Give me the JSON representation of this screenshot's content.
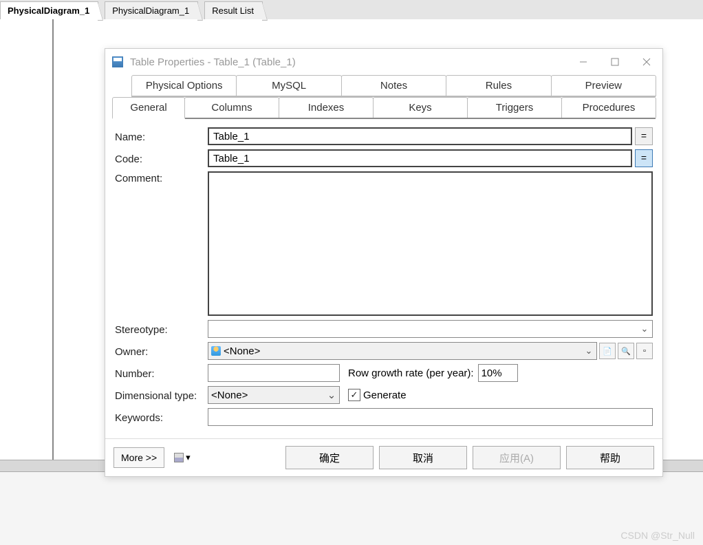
{
  "bg_tabs": [
    "PhysicalDiagram_1",
    "PhysicalDiagram_1",
    "Result List"
  ],
  "bg_active_tab": 0,
  "dialog": {
    "title": "Table Properties - Table_1 (Table_1)",
    "tabs_row1": [
      "Physical Options",
      "MySQL",
      "Notes",
      "Rules",
      "Preview"
    ],
    "tabs_row2": [
      "General",
      "Columns",
      "Indexes",
      "Keys",
      "Triggers",
      "Procedures"
    ],
    "active_tab": "General",
    "form": {
      "name_label": "Name:",
      "name_value": "Table_1",
      "code_label": "Code:",
      "code_value": "Table_1",
      "comment_label": "Comment:",
      "comment_value": "",
      "stereotype_label": "Stereotype:",
      "stereotype_value": "",
      "owner_label": "Owner:",
      "owner_value": "<None>",
      "number_label": "Number:",
      "number_value": "",
      "rowgrowth_label": "Row growth rate (per year):",
      "rowgrowth_value": "10%",
      "dimtype_label": "Dimensional type:",
      "dimtype_value": "<None>",
      "generate_label": "Generate",
      "generate_checked": true,
      "keywords_label": "Keywords:",
      "keywords_value": "",
      "eq_btn": "="
    },
    "footer": {
      "more": "More >>",
      "ok": "确定",
      "cancel": "取消",
      "apply": "应用(A)",
      "help": "帮助"
    }
  },
  "watermark": "CSDN @Str_Null"
}
